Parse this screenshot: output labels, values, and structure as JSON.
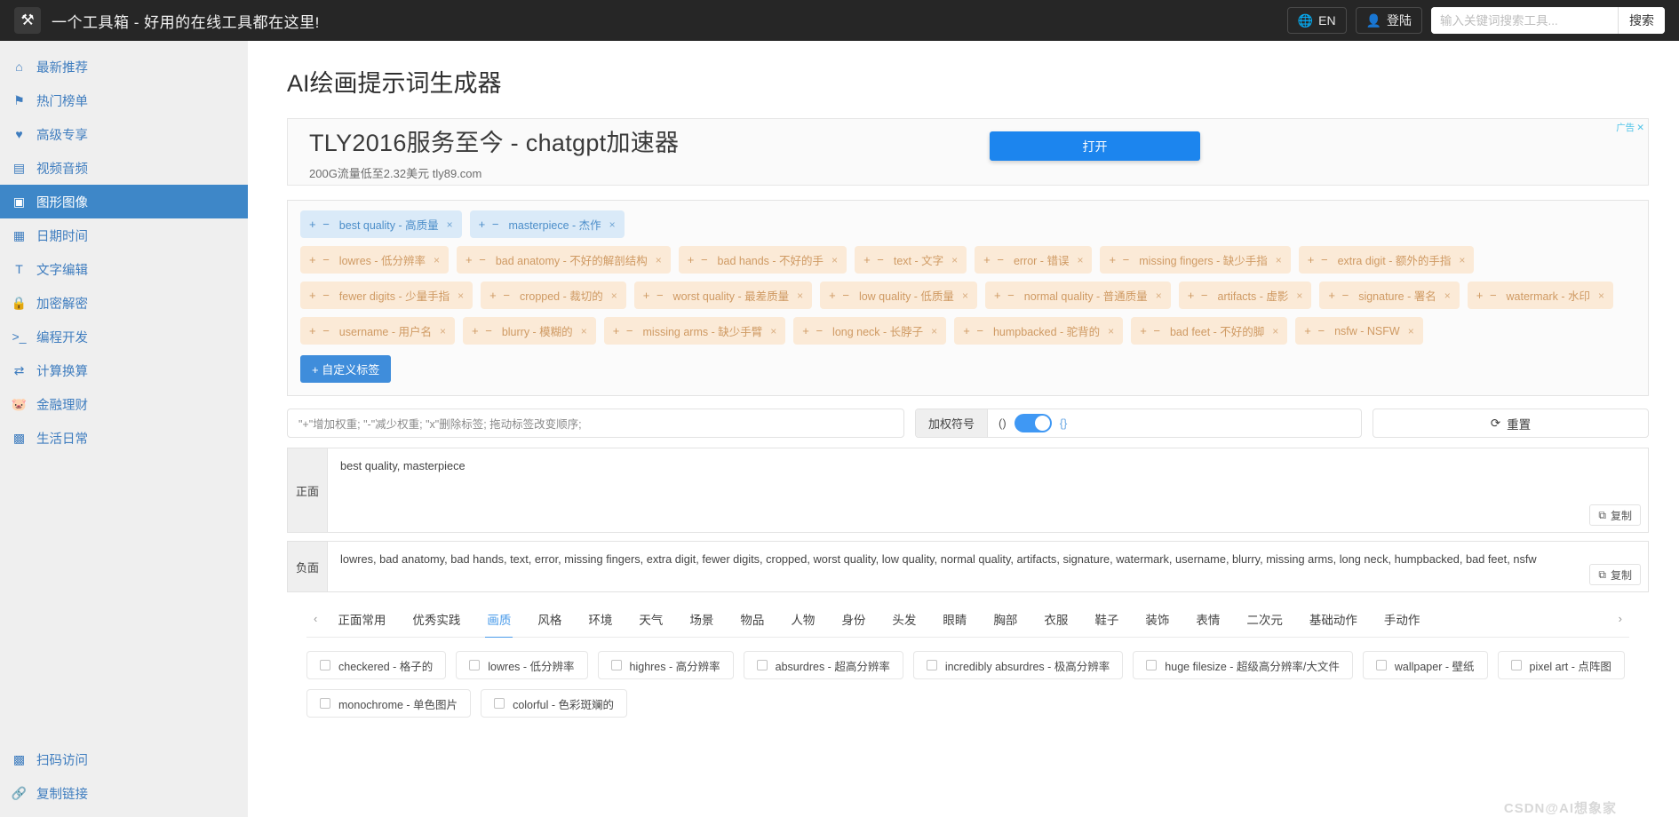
{
  "topbar": {
    "logo_icon": "toolbox-icon",
    "brand": "一个工具箱 - 好用的在线工具都在这里!",
    "lang_label": "EN",
    "login_label": "登陆",
    "search_placeholder": "输入关键词搜索工具...",
    "search_value": "",
    "search_button": "搜索"
  },
  "sidebar": {
    "items": [
      {
        "icon": "home-icon",
        "glyph": "⌂",
        "label": "最新推荐",
        "active": false
      },
      {
        "icon": "flag-icon",
        "glyph": "⚑",
        "label": "热门榜单",
        "active": false
      },
      {
        "icon": "heart-icon",
        "glyph": "♥",
        "label": "高级专享",
        "active": false
      },
      {
        "icon": "film-icon",
        "glyph": "▤",
        "label": "视频音频",
        "active": false
      },
      {
        "icon": "image-icon",
        "glyph": "▣",
        "label": "图形图像",
        "active": true
      },
      {
        "icon": "calendar-icon",
        "glyph": "▦",
        "label": "日期时间",
        "active": false
      },
      {
        "icon": "text-icon",
        "glyph": "T",
        "label": "文字编辑",
        "active": false
      },
      {
        "icon": "lock-icon",
        "glyph": "🔒",
        "label": "加密解密",
        "active": false
      },
      {
        "icon": "terminal-icon",
        "glyph": ">_",
        "label": "编程开发",
        "active": false
      },
      {
        "icon": "exchange-icon",
        "glyph": "⇄",
        "label": "计算换算",
        "active": false
      },
      {
        "icon": "piggybank-icon",
        "glyph": "🐷",
        "label": "金融理财",
        "active": false
      },
      {
        "icon": "life-icon",
        "glyph": "▩",
        "label": "生活日常",
        "active": false
      }
    ],
    "bottom_items": [
      {
        "icon": "qrcode-icon",
        "glyph": "▩",
        "label": "扫码访问"
      },
      {
        "icon": "link-icon",
        "glyph": "🔗",
        "label": "复制链接"
      }
    ]
  },
  "page": {
    "title": "AI绘画提示词生成器"
  },
  "ad": {
    "title": "TLY2016服务至今 - chatgpt加速器",
    "subtitle": "200G流量低至2.32美元 tly89.com",
    "button": "打开",
    "flag": "广告",
    "close_icon": "close-icon"
  },
  "tags": {
    "positive": [
      {
        "text": "best quality - 高质量"
      },
      {
        "text": "masterpiece - 杰作"
      }
    ],
    "negative": [
      {
        "text": "lowres - 低分辨率"
      },
      {
        "text": "bad anatomy - 不好的解剖结构"
      },
      {
        "text": "bad hands - 不好的手"
      },
      {
        "text": "text - 文字"
      },
      {
        "text": "error - 错误"
      },
      {
        "text": "missing fingers - 缺少手指"
      },
      {
        "text": "extra digit - 额外的手指"
      },
      {
        "text": "fewer digits - 少量手指"
      },
      {
        "text": "cropped - 裁切的"
      },
      {
        "text": "worst quality - 最差质量"
      },
      {
        "text": "low quality - 低质量"
      },
      {
        "text": "normal quality - 普通质量"
      },
      {
        "text": "artifacts - 虚影"
      },
      {
        "text": "signature - 署名"
      },
      {
        "text": "watermark - 水印"
      },
      {
        "text": "username - 用户名"
      },
      {
        "text": "blurry - 模糊的"
      },
      {
        "text": "missing arms - 缺少手臂"
      },
      {
        "text": "long neck - 长脖子"
      },
      {
        "text": "humpbacked - 驼背的"
      },
      {
        "text": "bad feet - 不好的脚"
      },
      {
        "text": "nsfw - NSFW"
      }
    ],
    "plus_minus": "+ −",
    "remove_icon": "×",
    "custom_tag_button": "+ 自定义标签"
  },
  "controls": {
    "hint": "\"+\"增加权重; \"-\"减少权重; \"x\"删除标签; 拖动标签改变顺序;",
    "weight_label": "加权符号",
    "weight_left": "()",
    "weight_right": "{}",
    "weight_toggle_on": true,
    "reset_label": "重置",
    "reset_icon": "refresh-icon"
  },
  "prompts": {
    "positive_label": "正面",
    "positive_value": "best quality, masterpiece",
    "negative_label": "负面",
    "negative_value": "lowres, bad anatomy, bad hands, text, error, missing fingers, extra digit, fewer digits, cropped, worst quality, low quality, normal quality, artifacts, signature, watermark, username, blurry, missing arms, long neck, humpbacked, bad feet, nsfw",
    "copy_label": "复制",
    "copy_icon": "copy-icon"
  },
  "tabs": {
    "prev_icon": "chevron-left-icon",
    "next_icon": "chevron-right-icon",
    "items": [
      {
        "label": "正面常用",
        "active": false
      },
      {
        "label": "优秀实践",
        "active": false
      },
      {
        "label": "画质",
        "active": true
      },
      {
        "label": "风格",
        "active": false
      },
      {
        "label": "环境",
        "active": false
      },
      {
        "label": "天气",
        "active": false
      },
      {
        "label": "场景",
        "active": false
      },
      {
        "label": "物品",
        "active": false
      },
      {
        "label": "人物",
        "active": false
      },
      {
        "label": "身份",
        "active": false
      },
      {
        "label": "头发",
        "active": false
      },
      {
        "label": "眼睛",
        "active": false
      },
      {
        "label": "胸部",
        "active": false
      },
      {
        "label": "衣服",
        "active": false
      },
      {
        "label": "鞋子",
        "active": false
      },
      {
        "label": "装饰",
        "active": false
      },
      {
        "label": "表情",
        "active": false
      },
      {
        "label": "二次元",
        "active": false
      },
      {
        "label": "基础动作",
        "active": false
      },
      {
        "label": "手动作",
        "active": false
      }
    ]
  },
  "chips": [
    {
      "label": "checkered - 格子的",
      "checked": false
    },
    {
      "label": "lowres - 低分辨率",
      "checked": false
    },
    {
      "label": "highres - 高分辨率",
      "checked": false
    },
    {
      "label": "absurdres - 超高分辨率",
      "checked": false
    },
    {
      "label": "incredibly absurdres - 极高分辨率",
      "checked": false
    },
    {
      "label": "huge filesize - 超级高分辨率/大文件",
      "checked": false
    },
    {
      "label": "wallpaper - 壁纸",
      "checked": false
    },
    {
      "label": "pixel art - 点阵图",
      "checked": false
    },
    {
      "label": "monochrome - 单色图片",
      "checked": false
    },
    {
      "label": "colorful - 色彩斑斓的",
      "checked": false
    }
  ],
  "watermark": "CSDN@AI想象家",
  "colors": {
    "accent": "#3e87c8",
    "ad_button": "#1c85ee",
    "positive_tag_bg": "#daeaf8",
    "negative_tag_bg": "#fbead7",
    "topbar_bg": "#262626",
    "sidebar_bg": "#efefef"
  }
}
